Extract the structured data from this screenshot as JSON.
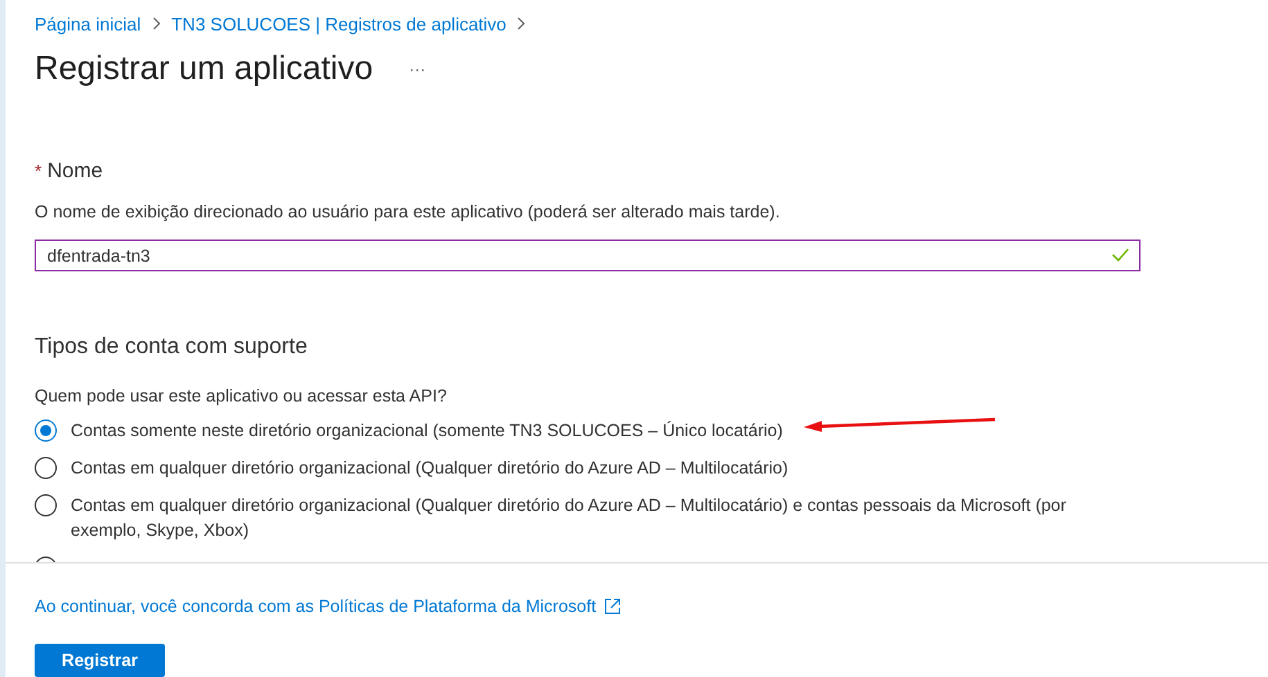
{
  "breadcrumb": [
    {
      "label": "Página inicial"
    },
    {
      "label": "TN3 SOLUCOES | Registros de aplicativo"
    }
  ],
  "title": "Registrar um aplicativo",
  "more_label": "···",
  "name_field": {
    "required_mark": "*",
    "label": "Nome",
    "description": "O nome de exibição direcionado ao usuário para este aplicativo (poderá ser alterado mais tarde).",
    "value": "dfentrada-tn3",
    "valid": true
  },
  "account_types": {
    "heading": "Tipos de conta com suporte",
    "question": "Quem pode usar este aplicativo ou acessar esta API?",
    "options": [
      {
        "label": "Contas somente neste diretório organizacional (somente TN3 SOLUCOES – Único locatário)",
        "selected": true
      },
      {
        "label": "Contas em qualquer diretório organizacional (Qualquer diretório do Azure AD – Multilocatário)",
        "selected": false
      },
      {
        "label": "Contas em qualquer diretório organizacional (Qualquer diretório do Azure AD – Multilocatário) e contas pessoais da Microsoft (por exemplo, Skype, Xbox)",
        "selected": false
      },
      {
        "selected": false
      }
    ]
  },
  "footer": {
    "policy_link": "Ao continuar, você concorda com as Políticas de Plataforma da Microsoft",
    "button": "Registrar"
  }
}
